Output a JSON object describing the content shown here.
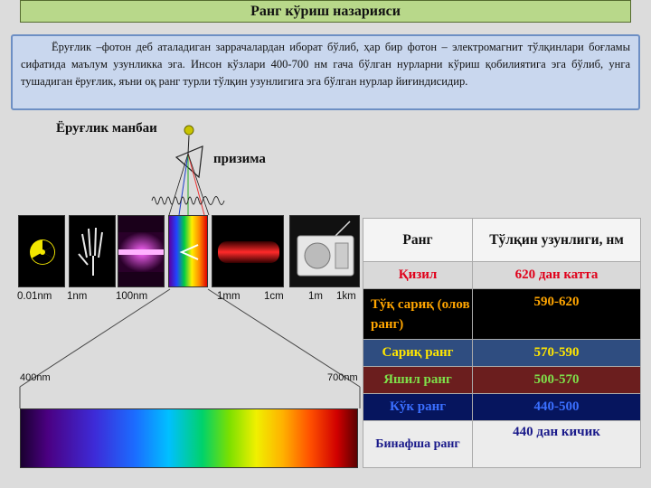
{
  "title": "Ранг кўриш назарияси",
  "intro_text": "Ёруғлик –фотон деб аталадиган заррачалардан иборат бўлиб, ҳар бир фотон – электромагнит тўлқинлари боғламы сифатида маълум узунликка эга. Инсон кўзлари 400-700 нм гача бўлган нурларни кўриш қобилиятига эга бўлиб, унга тушадиган ёруғлик, яъни оқ ранг турли тўлқин узунлигига эга бўлган нурлар йиғиндисидир.",
  "diagram": {
    "light_source_label": "Ёруғлик манбаи",
    "prism_label": "призима",
    "scale_labels": [
      "0.01nm",
      "1nm",
      "100nm",
      "1mm",
      "1cm",
      "1m",
      "1km"
    ],
    "visible_start": "400nm",
    "visible_end": "700nm",
    "tile_icons": [
      "radiation-icon",
      "xray-hand-icon",
      "uv-bar-icon",
      "visible-spectrum-icon",
      "infrared-bar-icon",
      "radio-icon"
    ]
  },
  "table": {
    "headers": [
      "Ранг",
      "Тўлқин узунлиги, нм"
    ],
    "rows": [
      {
        "color": "Қизил",
        "range": "620 дан катта",
        "bg": "#d9d9d9",
        "fg": "#e0001a"
      },
      {
        "color": "Тўқ сариқ (олов ранг)",
        "range": "590-620",
        "bg": "#000000",
        "fg": "#ffa500"
      },
      {
        "color": "Сариқ ранг",
        "range": "570-590",
        "bg": "#2f4d80",
        "fg": "#ffe600"
      },
      {
        "color": "Яшил ранг",
        "range": "500-570",
        "bg": "#6b1e1e",
        "fg": "#7ee04a"
      },
      {
        "color": "Кўк ранг",
        "range": "440-500",
        "bg": "#06155e",
        "fg": "#3a6fff"
      },
      {
        "color": "Бинафша ранг",
        "range": "440 дан кичик",
        "bg": "#ececec",
        "fg": "#1a1a8a"
      }
    ]
  }
}
